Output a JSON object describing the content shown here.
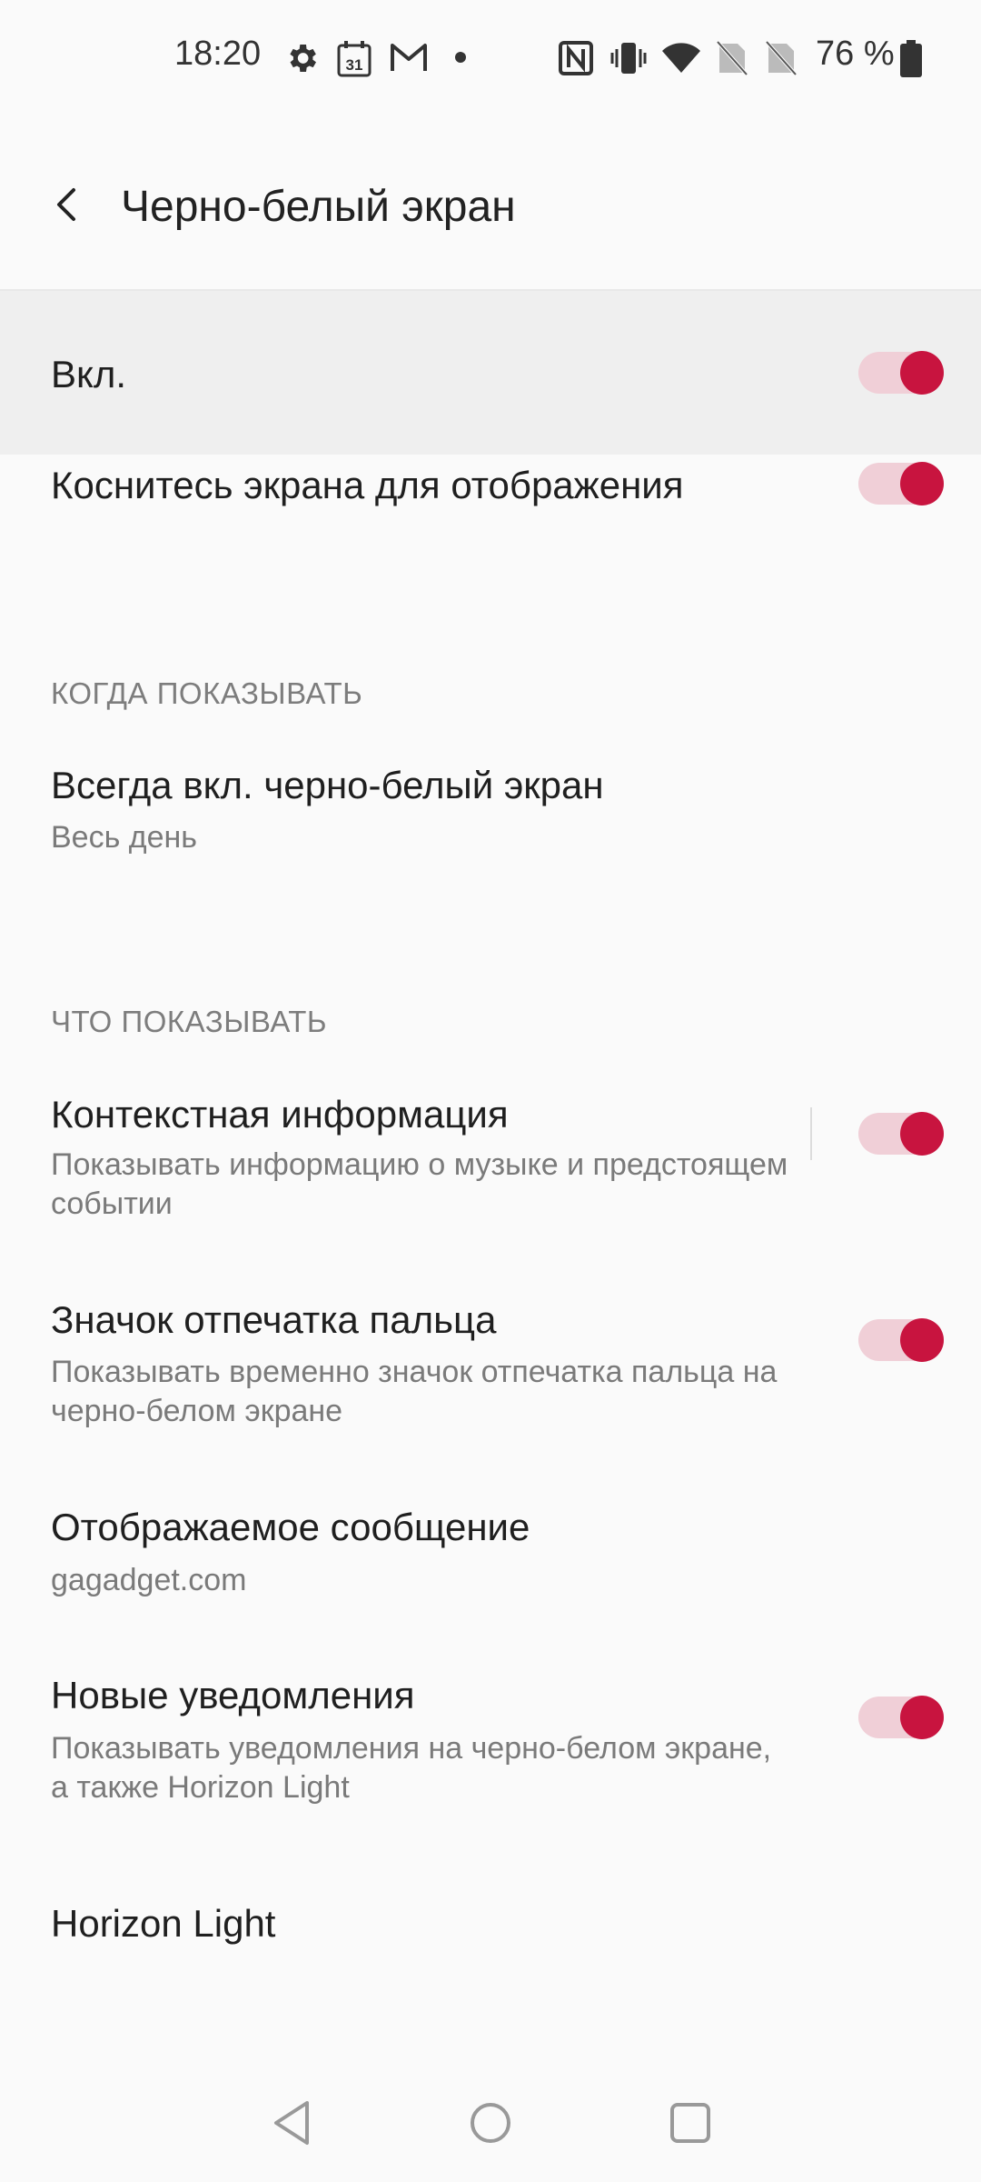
{
  "status_bar": {
    "time": "18:20",
    "calendar_day": "31",
    "battery_text": "76 %",
    "icons": [
      "gear-icon",
      "calendar-icon",
      "gmail-icon",
      "dot-icon",
      "nfc-icon",
      "vibrate-icon",
      "wifi-icon",
      "no-sim-icon",
      "no-sim-icon",
      "battery-icon"
    ]
  },
  "app_bar": {
    "title": "Черно-белый экран",
    "back_icon": "back-arrow-icon"
  },
  "colors": {
    "accent": "#c8143f",
    "toggle_track": "#f0cfd7",
    "highlight_row": "#efefef"
  },
  "settings": {
    "on": {
      "label": "Вкл.",
      "enabled": true
    },
    "tap_to_show": {
      "label": "Коснитесь экрана для отображения",
      "enabled": true
    },
    "when_section": "КОГДА ПОКАЗЫВАТЬ",
    "always_on": {
      "label": "Всегда вкл. черно-белый экран",
      "summary": "Весь день"
    },
    "what_section": "ЧТО ПОКАЗЫВАТЬ",
    "context_info": {
      "label": "Контекстная информация",
      "summary": "Показывать информацию о музыке и предстоящем событии",
      "enabled": true
    },
    "fingerprint": {
      "label": "Значок отпечатка пальца",
      "summary": "Показывать временно значок отпечатка пальца на черно-белом экране",
      "enabled": true
    },
    "message": {
      "label": "Отображаемое сообщение",
      "summary": "gagadget.com"
    },
    "notifications": {
      "label": "Новые уведомления",
      "summary": "Показывать уведомления на черно-белом экране, а также Horizon Light",
      "enabled": true
    },
    "horizon_light": {
      "label": "Horizon Light"
    }
  },
  "nav_bar": {
    "back": "nav-back-icon",
    "home": "nav-home-icon",
    "recents": "nav-recents-icon"
  }
}
